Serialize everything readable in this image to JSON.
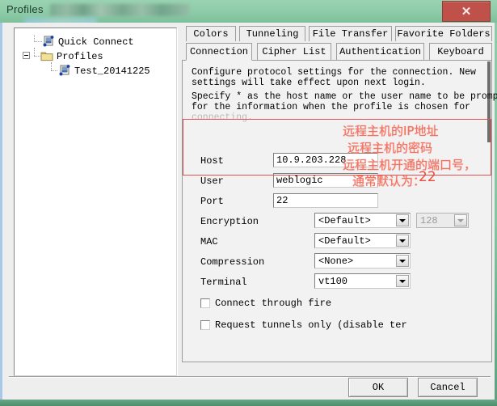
{
  "window": {
    "title": "Profiles",
    "close_label": "✕"
  },
  "tree": {
    "items": [
      {
        "label": "Quick Connect",
        "icon": "session-icon",
        "indent": 1
      },
      {
        "label": "Profiles",
        "icon": "folder-icon",
        "indent": 0,
        "expanded": true
      },
      {
        "label": "Test_20141225",
        "icon": "session-icon",
        "indent": 2
      }
    ]
  },
  "tabs": {
    "row1": [
      {
        "label": "Colors",
        "active": false
      },
      {
        "label": "Tunneling",
        "active": false
      },
      {
        "label": "File Transfer",
        "active": false
      },
      {
        "label": "Favorite Folders",
        "active": false
      }
    ],
    "row2": [
      {
        "label": "Connection",
        "active": true
      },
      {
        "label": "Cipher List",
        "active": false
      },
      {
        "label": "Authentication",
        "active": false
      },
      {
        "label": "Keyboard",
        "active": false
      }
    ]
  },
  "connection": {
    "desc_line1": "Configure protocol settings for the connection. New",
    "desc_line2": "settings will take effect upon next login.",
    "desc_line3": "Specify * as the host name or the user name to be prompted",
    "desc_line4": "for the information when the profile is chosen for",
    "desc_line5": "connecting.",
    "fields": {
      "host_label": "Host",
      "host_value": "10.9.203.228",
      "user_label": "User",
      "user_value": "weblogic",
      "port_label": "Port",
      "port_value": "22",
      "encryption_label": "Encryption",
      "encryption_value": "<Default>",
      "encryption_bits_value": "128",
      "mac_label": "MAC",
      "mac_value": "<Default>",
      "compression_label": "Compression",
      "compression_value": "<None>",
      "terminal_label": "Terminal",
      "terminal_value": "vt100"
    },
    "checkboxes": [
      {
        "label": "Connect through fire",
        "checked": false
      },
      {
        "label": "Request tunnels only (disable ter",
        "checked": false
      }
    ]
  },
  "annotations": {
    "host_note": "远程主机的IP地址",
    "user_note": "远程主机的密码",
    "port_note_1": "远程主机开通的端口号，",
    "port_note_2": "通常默认为：",
    "port_note_value": "22",
    "box_color": "#e05050",
    "text_color": "#f4705f"
  },
  "buttons": {
    "ok": "OK",
    "cancel": "Cancel"
  }
}
